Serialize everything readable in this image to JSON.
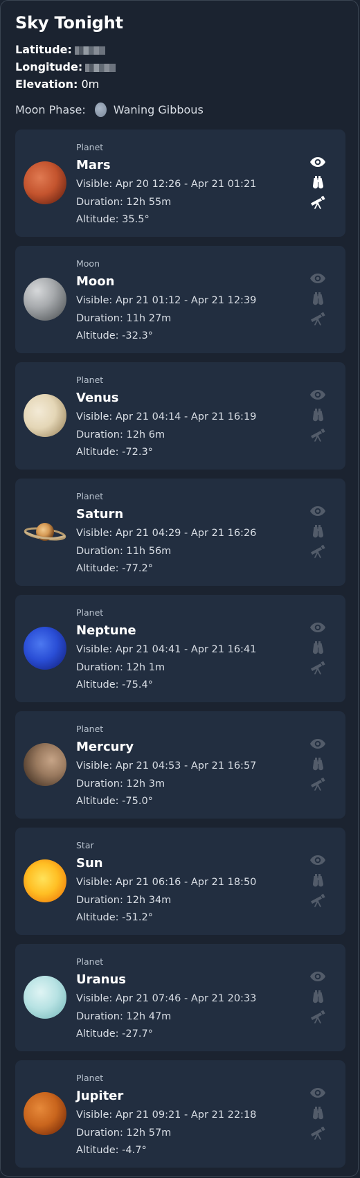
{
  "header": {
    "title": "Sky Tonight",
    "latitude_label": "Latitude:",
    "longitude_label": "Longitude:",
    "elevation_label": "Elevation:",
    "elevation_value": "0m",
    "moon_phase_label": "Moon Phase:",
    "moon_phase_value": "Waning Gibbous"
  },
  "objects": [
    {
      "kind": "Planet",
      "name": "Mars",
      "visible": "Visible: Apr 20 12:26 - Apr 21 01:21",
      "duration": "Duration: 12h 55m",
      "altitude": "Altitude: 35.5°",
      "naked_eye": true,
      "binoculars": true,
      "telescope": true
    },
    {
      "kind": "Moon",
      "name": "Moon",
      "visible": "Visible: Apr 21 01:12 - Apr 21 12:39",
      "duration": "Duration: 11h 27m",
      "altitude": "Altitude: -32.3°",
      "naked_eye": false,
      "binoculars": false,
      "telescope": false
    },
    {
      "kind": "Planet",
      "name": "Venus",
      "visible": "Visible: Apr 21 04:14 - Apr 21 16:19",
      "duration": "Duration: 12h 6m",
      "altitude": "Altitude: -72.3°",
      "naked_eye": false,
      "binoculars": false,
      "telescope": false
    },
    {
      "kind": "Planet",
      "name": "Saturn",
      "visible": "Visible: Apr 21 04:29 - Apr 21 16:26",
      "duration": "Duration: 11h 56m",
      "altitude": "Altitude: -77.2°",
      "naked_eye": false,
      "binoculars": false,
      "telescope": false
    },
    {
      "kind": "Planet",
      "name": "Neptune",
      "visible": "Visible: Apr 21 04:41 - Apr 21 16:41",
      "duration": "Duration: 12h 1m",
      "altitude": "Altitude: -75.4°",
      "naked_eye": false,
      "binoculars": false,
      "telescope": false
    },
    {
      "kind": "Planet",
      "name": "Mercury",
      "visible": "Visible: Apr 21 04:53 - Apr 21 16:57",
      "duration": "Duration: 12h 3m",
      "altitude": "Altitude: -75.0°",
      "naked_eye": false,
      "binoculars": false,
      "telescope": false
    },
    {
      "kind": "Star",
      "name": "Sun",
      "visible": "Visible: Apr 21 06:16 - Apr 21 18:50",
      "duration": "Duration: 12h 34m",
      "altitude": "Altitude: -51.2°",
      "naked_eye": false,
      "binoculars": false,
      "telescope": false
    },
    {
      "kind": "Planet",
      "name": "Uranus",
      "visible": "Visible: Apr 21 07:46 - Apr 21 20:33",
      "duration": "Duration: 12h 47m",
      "altitude": "Altitude: -27.7°",
      "naked_eye": false,
      "binoculars": false,
      "telescope": false
    },
    {
      "kind": "Planet",
      "name": "Jupiter",
      "visible": "Visible: Apr 21 09:21 - Apr 21 22:18",
      "duration": "Duration: 12h 57m",
      "altitude": "Altitude: -4.7°",
      "naked_eye": false,
      "binoculars": false,
      "telescope": false
    }
  ],
  "icons": {
    "naked_eye": "eye-icon",
    "binoculars": "binoculars-icon",
    "telescope": "telescope-icon"
  },
  "colors": {
    "background": "#1b2330",
    "card": "#222e40",
    "icon_active": "#ffffff"
  }
}
